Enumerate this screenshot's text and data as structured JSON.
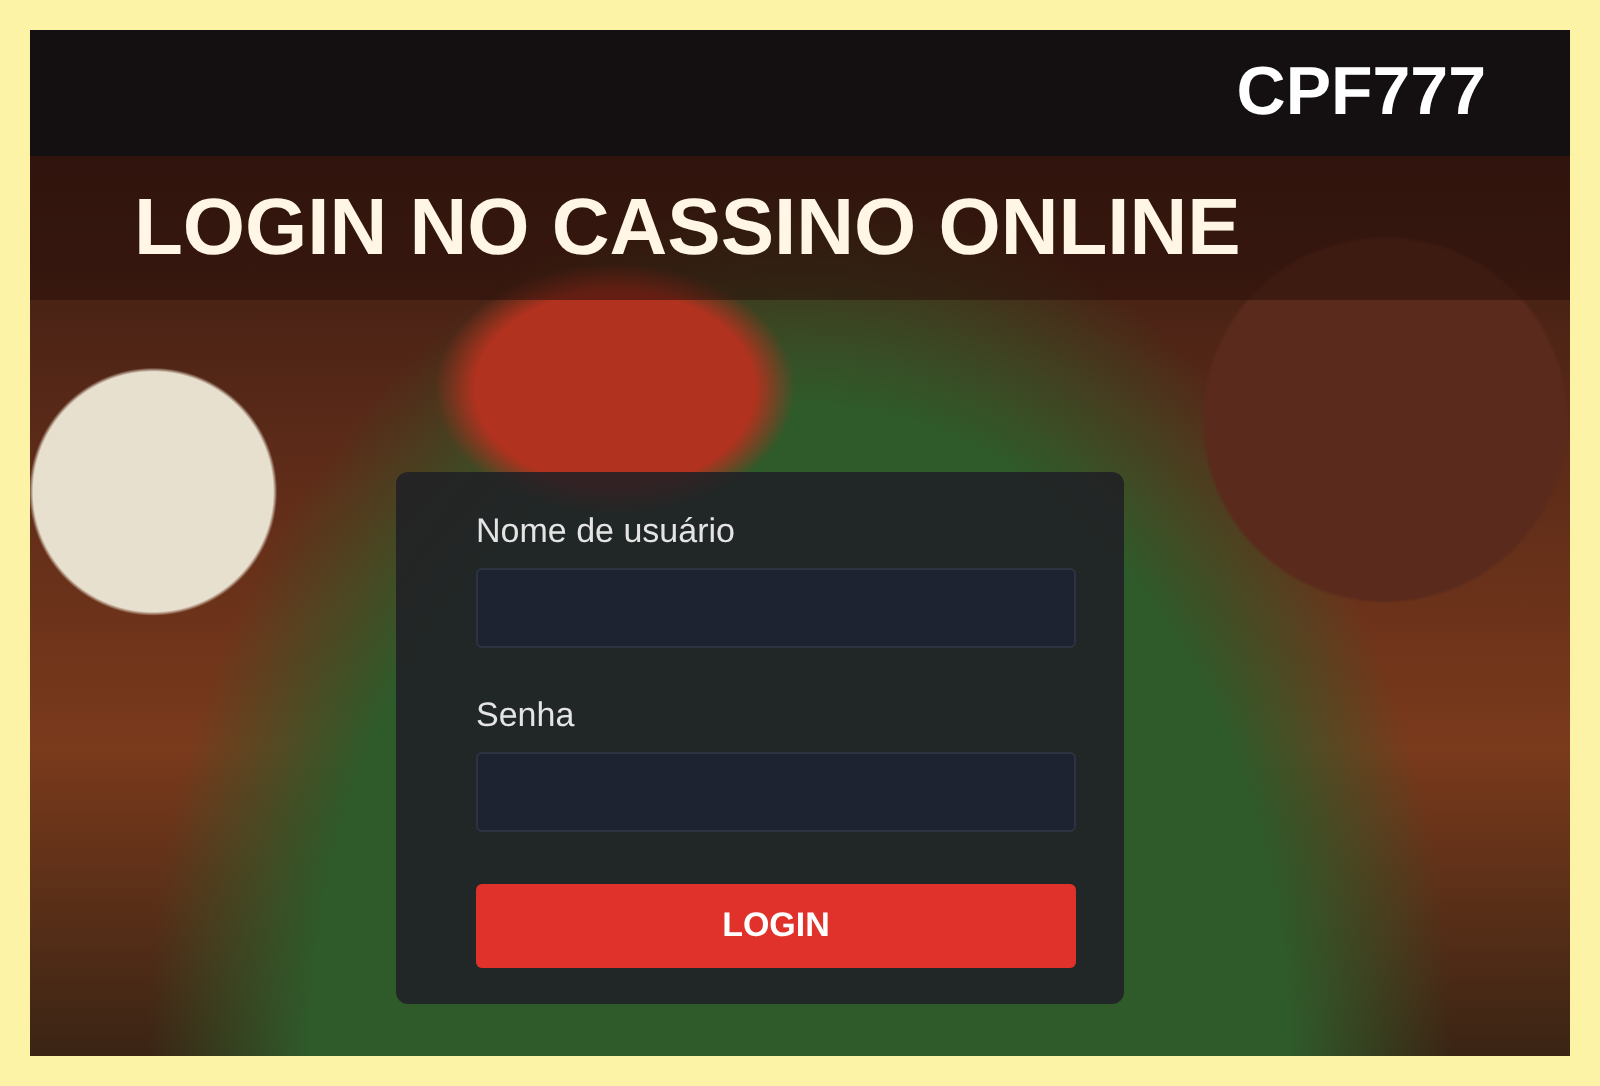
{
  "header": {
    "brand": "CPF777",
    "title": "LOGIN NO CASSINO ONLINE"
  },
  "form": {
    "fields": [
      {
        "label": "Nome de usuário"
      },
      {
        "label": "Senha"
      }
    ],
    "button": "LOGIN"
  }
}
